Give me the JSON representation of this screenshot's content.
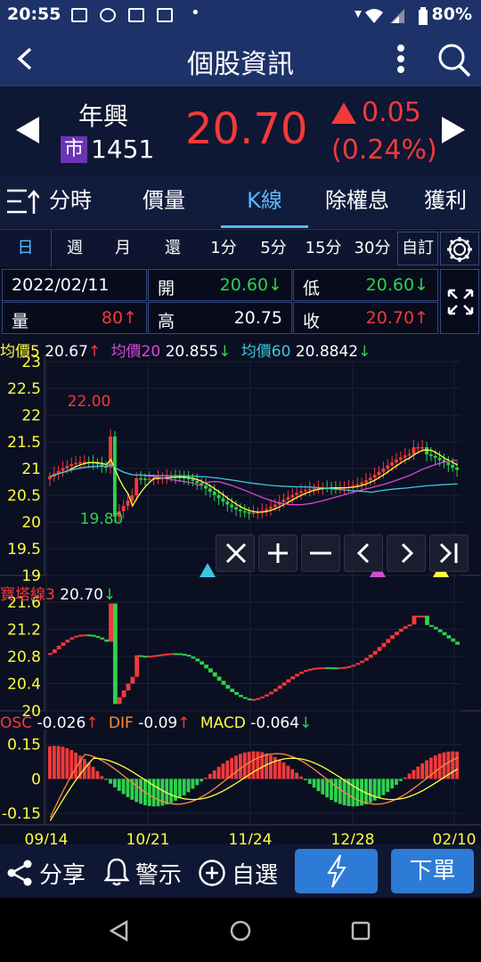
{
  "status_bar": {
    "time": "20:55",
    "battery": "80%"
  },
  "header": {
    "title": "個股資訊"
  },
  "stock": {
    "name": "年興",
    "market": "市",
    "code": "1451",
    "price": "20.70",
    "change": "0.05",
    "change_pct": "(0.24%)",
    "colors": {
      "up": "#f23a3a",
      "down": "#2ed14d",
      "accent": "#5ab8ff"
    }
  },
  "tabs": [
    "分時",
    "價量",
    "K線",
    "除權息",
    "獲利"
  ],
  "active_tab": "K線",
  "periods": [
    "日",
    "週",
    "月",
    "還",
    "1分",
    "5分",
    "15分",
    "30分",
    "自訂"
  ],
  "active_period": "日",
  "info": {
    "date": "2022/02/11",
    "open_label": "開",
    "open_value": "20.60",
    "low_label": "低",
    "low_value": "20.60",
    "volume_label": "量",
    "volume_value": "80",
    "high_label": "高",
    "high_value": "20.75",
    "close_label": "收",
    "close_value": "20.70"
  },
  "ma_legend": {
    "ma5_label": "均價5",
    "ma5_value": "20.67",
    "ma20_label": "均價20",
    "ma20_value": "20.855",
    "ma60_label": "均價60",
    "ma60_value": "20.8842"
  },
  "tower_legend": {
    "label": "寶塔線3",
    "value": "20.70"
  },
  "macd_legend": {
    "osc_label": "OSC",
    "osc_value": "-0.026",
    "dif_label": "DIF",
    "dif_value": "-0.09",
    "macd_label": "MACD",
    "macd_value": "-0.064"
  },
  "actions": {
    "share": "分享",
    "alert": "警示",
    "watch": "自選",
    "order": "下單"
  },
  "chart_data": [
    {
      "type": "candlestick",
      "y_ticks": [
        "23",
        "22.5",
        "22",
        "21.5",
        "21",
        "20.5",
        "20",
        "19.5",
        "19"
      ],
      "ylim": [
        19,
        23
      ],
      "max_label": "22.00",
      "min_label": "19.80",
      "x_ticks": [
        "09/14",
        "10/21",
        "11/24",
        "12/28",
        "02/10"
      ],
      "series": [
        {
          "name": "均價5",
          "color": "#ffff3a"
        },
        {
          "name": "均價20",
          "color": "#d44bd4"
        },
        {
          "name": "均價60",
          "color": "#3ac7e0"
        }
      ]
    },
    {
      "type": "tower",
      "y_ticks": [
        "21.6",
        "21.2",
        "20.8",
        "20.4",
        "20"
      ],
      "ylim": [
        20,
        21.6
      ]
    },
    {
      "type": "bar",
      "y_ticks": [
        "0.15",
        "0",
        "-0.15"
      ],
      "ylim": [
        -0.2,
        0.18
      ],
      "series": [
        {
          "name": "OSC",
          "color": "#f23a3a"
        },
        {
          "name": "DIF",
          "color": "#ff8c3a"
        },
        {
          "name": "MACD",
          "color": "#ffff3a"
        }
      ]
    }
  ]
}
